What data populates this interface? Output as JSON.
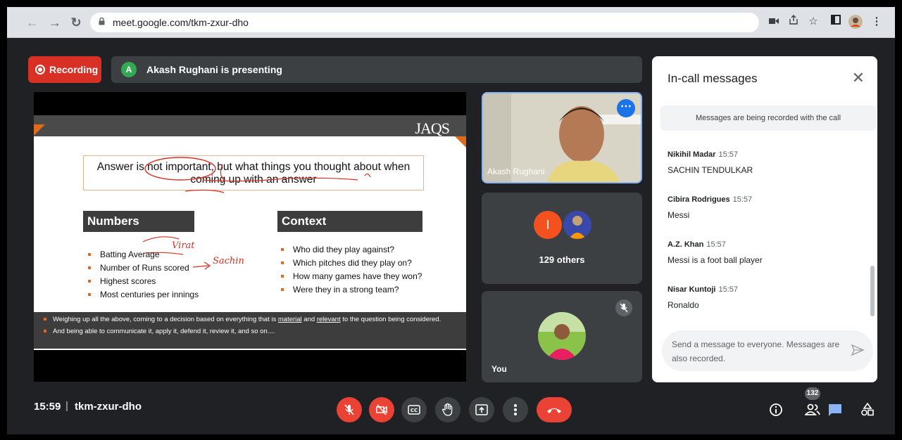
{
  "browser": {
    "url": "meet.google.com/tkm-zxur-dho"
  },
  "recording": {
    "label": "Recording"
  },
  "presenting": {
    "avatar_initial": "A",
    "text": "Akash Rughani is presenting"
  },
  "slide": {
    "logo": "JAQS",
    "headline_line1": "Answer is not important, but what things you thought about when",
    "headline_line2": "coming up with an answer",
    "numbers": {
      "heading": "Numbers",
      "items": [
        "Batting Average",
        "Number of Runs scored",
        "Highest scores",
        "Most centuries per innings"
      ],
      "annotations": [
        "Virat",
        "Sachin"
      ]
    },
    "context": {
      "heading": "Context",
      "items": [
        "Who did they play against?",
        "Which pitches did they play on?",
        "How many games have they won?",
        "Were they in a strong team?"
      ]
    },
    "footer": {
      "line1_pre": "Weighing up all the above, coming to a decision based on everything that is ",
      "line1_u1": "material",
      "line1_mid": " and ",
      "line1_u2": "relevant",
      "line1_post": " to the question being considered.",
      "line2": "And being able to communicate it, apply it, defend it, review it, and so on...."
    },
    "accent": "#e06c1b"
  },
  "tiles": {
    "presenter_name": "Akash Rughani",
    "others_initial": "I",
    "others_label": "129 others",
    "self_label": "You"
  },
  "chat": {
    "title": "In-call messages",
    "note": "Messages are being recorded with the call",
    "messages": [
      {
        "sender": "Nikihil Madar",
        "time": "15:57",
        "text": "SACHIN TENDULKAR"
      },
      {
        "sender": "Cibira Rodrigues",
        "time": "15:57",
        "text": "Messi"
      },
      {
        "sender": "A.Z. Khan",
        "time": "15:57",
        "text": "Messi is a foot ball player"
      },
      {
        "sender": "Nisar Kuntoji",
        "time": "15:57",
        "text": "Ronaldo"
      }
    ],
    "input_placeholder": "Send a message to everyone. Messages are also recorded."
  },
  "bottom": {
    "time": "15:59",
    "separator": "|",
    "meeting_code": "tkm-zxur-dho",
    "people_count": "132"
  },
  "colors": {
    "meet_bg": "#202124",
    "tile_bg": "#3c4043",
    "red": "#ea4335",
    "blue": "#1a73e8"
  }
}
